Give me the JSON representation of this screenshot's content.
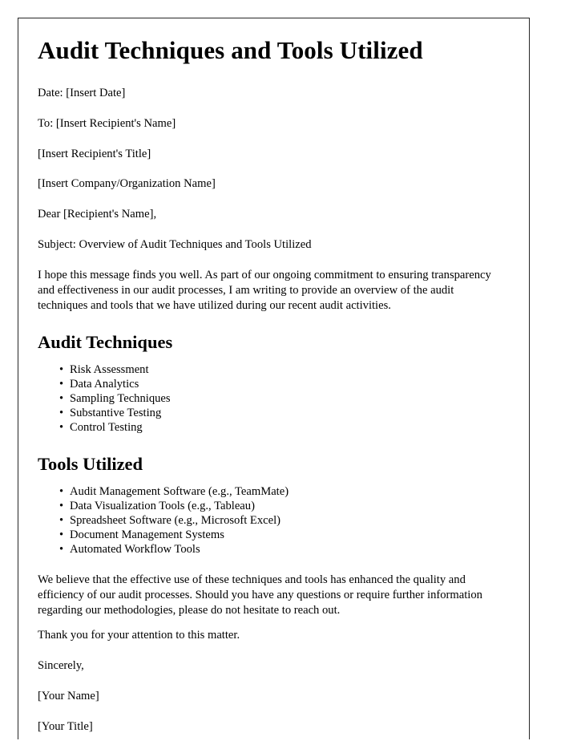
{
  "document": {
    "title": "Audit Techniques and Tools Utilized",
    "header_lines": [
      "Date: [Insert Date]",
      "To: [Insert Recipient's Name]",
      "[Insert Recipient's Title]",
      "[Insert Company/Organization Name]",
      "Dear [Recipient's Name],",
      "Subject: Overview of Audit Techniques and Tools Utilized"
    ],
    "intro_paragraph": "I hope this message finds you well. As part of our ongoing commitment to ensuring transparency and effectiveness in our audit processes, I am writing to provide an overview of the audit techniques and tools that we have utilized during our recent audit activities.",
    "sections": [
      {
        "heading": "Audit Techniques",
        "items": [
          "Risk Assessment",
          "Data Analytics",
          "Sampling Techniques",
          "Substantive Testing",
          "Control Testing"
        ]
      },
      {
        "heading": "Tools Utilized",
        "items": [
          "Audit Management Software (e.g., TeamMate)",
          "Data Visualization Tools (e.g., Tableau)",
          "Spreadsheet Software (e.g., Microsoft Excel)",
          "Document Management Systems",
          "Automated Workflow Tools"
        ]
      }
    ],
    "closing_paragraph": "We believe that the effective use of these techniques and tools has enhanced the quality and efficiency of our audit processes. Should you have any questions or require further information regarding our methodologies, please do not hesitate to reach out.",
    "thanks_line": "Thank you for your attention to this matter.",
    "signoff_lines": [
      "Sincerely,",
      "[Your Name]",
      "[Your Title]"
    ],
    "bullet_glyph": "•",
    "colors": {
      "text": "#000000",
      "page_border": "#262626",
      "background": "#ffffff"
    }
  }
}
